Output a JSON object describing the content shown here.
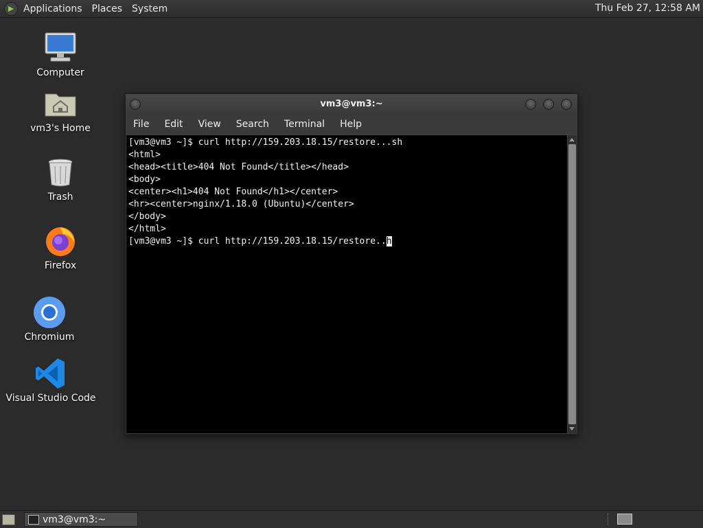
{
  "top_panel": {
    "menus": [
      "Applications",
      "Places",
      "System"
    ],
    "clock": "Thu Feb 27, 12:58 AM"
  },
  "desktop_icons": [
    {
      "label": "Computer",
      "icon": "computer-icon"
    },
    {
      "label": "vm3's Home",
      "icon": "home-folder-icon"
    },
    {
      "label": "Trash",
      "icon": "trash-icon"
    },
    {
      "label": "Firefox",
      "icon": "firefox-icon"
    },
    {
      "label": "Chromium",
      "icon": "chromium-icon"
    },
    {
      "label": "Visual Studio Code",
      "icon": "vscode-icon"
    }
  ],
  "terminal": {
    "title": "vm3@vm3:~",
    "menu": [
      "File",
      "Edit",
      "View",
      "Search",
      "Terminal",
      "Help"
    ],
    "lines": [
      "[vm3@vm3 ~]$ curl http://159.203.18.15/restore...sh",
      "<html>",
      "<head><title>404 Not Found</title></head>",
      "<body>",
      "<center><h1>404 Not Found</h1></center>",
      "<hr><center>nginx/1.18.0 (Ubuntu)</center>",
      "</body>",
      "</html>"
    ],
    "prompt_line": "[vm3@vm3 ~]$ curl http://159.203.18.15/restore..",
    "cursor_char": "h"
  },
  "taskbar": {
    "window_label": "vm3@vm3:~"
  },
  "colors": {
    "desktop_bg": "#2b2b2b",
    "panel_bg": "#333333",
    "terminal_bg": "#000000",
    "terminal_fg": "#f2f2f2"
  }
}
